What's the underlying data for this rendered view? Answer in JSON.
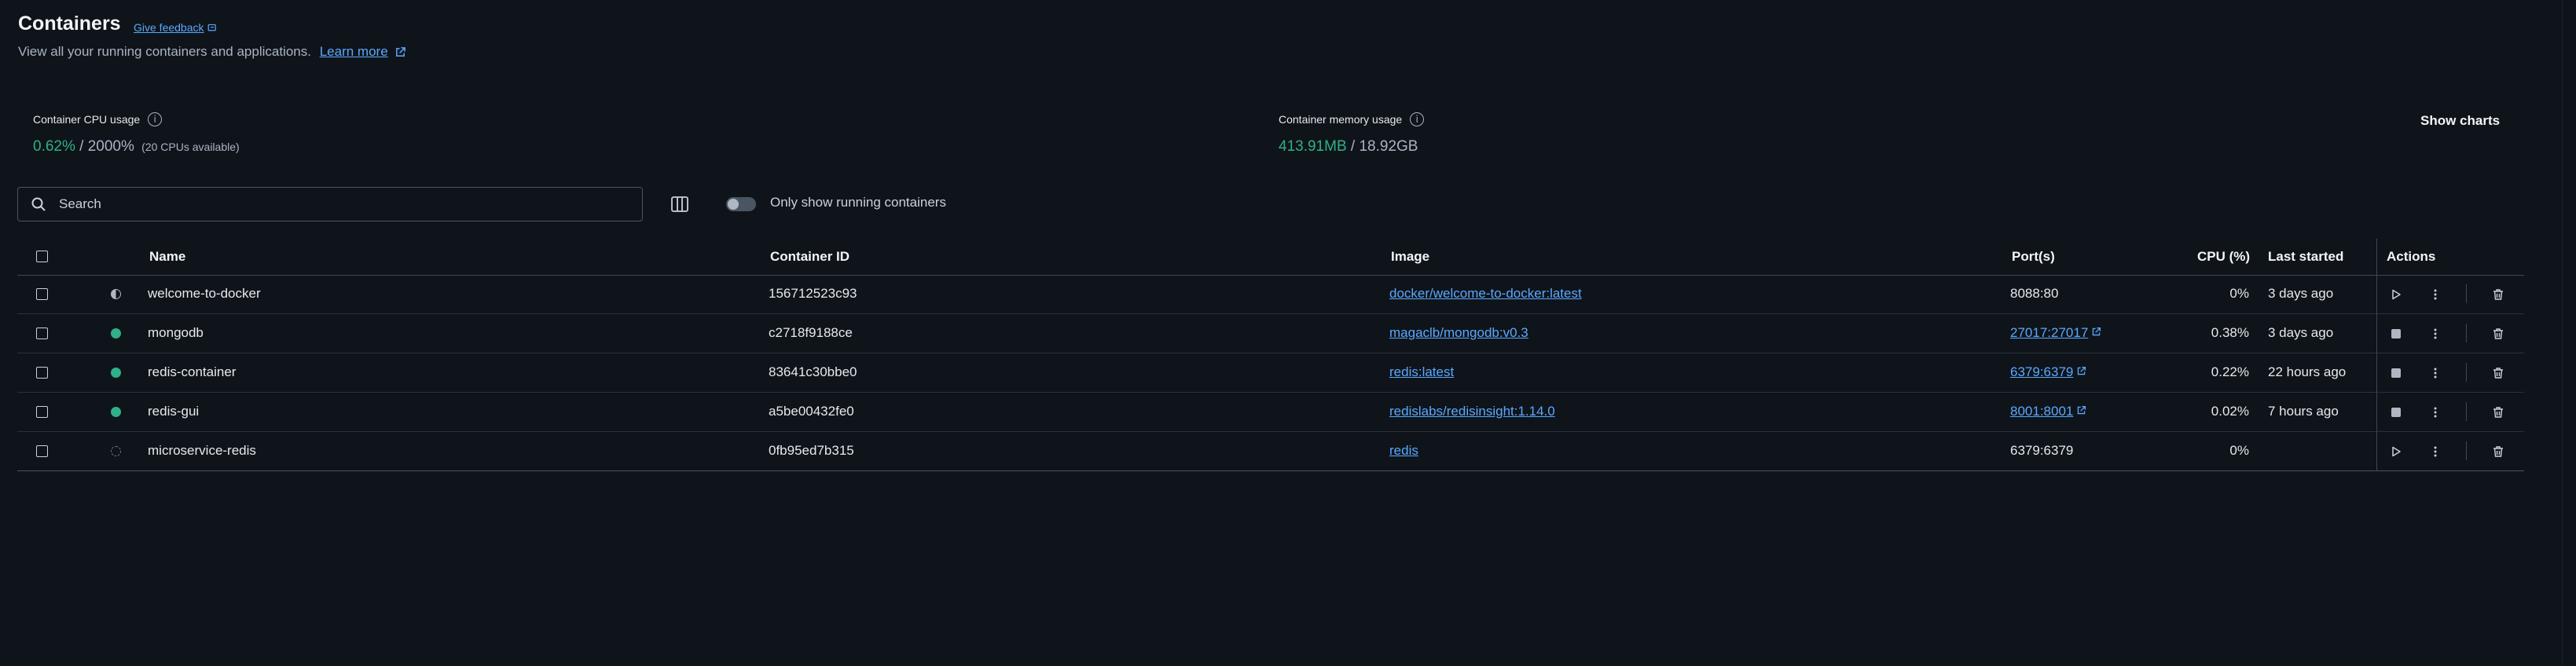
{
  "header": {
    "title": "Containers",
    "feedback": "Give feedback",
    "subtitle": "View all your running containers and applications.",
    "learn_more": "Learn more"
  },
  "stats": {
    "cpu_label": "Container CPU usage",
    "cpu_used": "0.62%",
    "cpu_total": "2000%",
    "cpu_note": "(20 CPUs available)",
    "mem_label": "Container memory usage",
    "mem_used": "413.91MB",
    "mem_total": "18.92GB",
    "show_charts": "Show charts"
  },
  "toolbar": {
    "search_placeholder": "Search",
    "toggle_label": "Only show running containers",
    "toggle_on": false
  },
  "table": {
    "headers": {
      "name": "Name",
      "container_id": "Container ID",
      "image": "Image",
      "ports": "Port(s)",
      "cpu": "CPU (%)",
      "last_started": "Last started",
      "actions": "Actions"
    },
    "rows": [
      {
        "status": "half",
        "name": "welcome-to-docker",
        "id": "156712523c93",
        "image": "docker/welcome-to-docker:latest",
        "ports": "8088:80",
        "ports_link": false,
        "cpu": "0%",
        "last_started": "3 days ago",
        "action": "start"
      },
      {
        "status": "running",
        "name": "mongodb",
        "id": "c2718f9188ce",
        "image": "magaclb/mongodb:v0.3",
        "ports": "27017:27017",
        "ports_link": true,
        "cpu": "0.38%",
        "last_started": "3 days ago",
        "action": "stop"
      },
      {
        "status": "running",
        "name": "redis-container",
        "id": "83641c30bbe0",
        "image": "redis:latest",
        "ports": "6379:6379",
        "ports_link": true,
        "cpu": "0.22%",
        "last_started": "22 hours ago",
        "action": "stop"
      },
      {
        "status": "running",
        "name": "redis-gui",
        "id": "a5be00432fe0",
        "image": "redislabs/redisinsight:1.14.0",
        "ports": "8001:8001",
        "ports_link": true,
        "cpu": "0.02%",
        "last_started": "7 hours ago",
        "action": "stop"
      },
      {
        "status": "stopped",
        "name": "microservice-redis",
        "id": "0fb95ed7b315",
        "image": "redis",
        "ports": "6379:6379",
        "ports_link": false,
        "cpu": "0%",
        "last_started": "",
        "action": "start"
      }
    ]
  },
  "colors": {
    "background": "#0f141a",
    "accent": "#5aa8ff",
    "running": "#2fb08a"
  }
}
